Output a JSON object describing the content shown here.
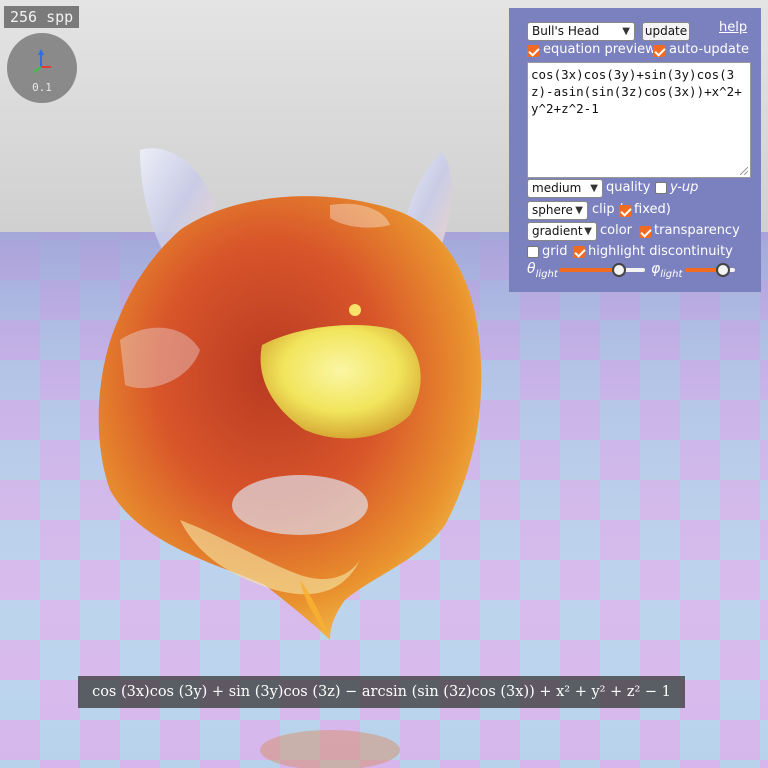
{
  "viewport": {
    "spp_label": "256 spp",
    "axis_scale": "0.1",
    "axis_colors": {
      "x": "#e23b3b",
      "y": "#2f6fe0",
      "z": "#3fbf4a"
    }
  },
  "panel": {
    "preset_select": "Bull's Head",
    "update_button": "update",
    "help_link": "help",
    "equation_preview": {
      "label": "equation preview",
      "checked": true
    },
    "auto_update": {
      "label": "auto-update",
      "checked": true
    },
    "equation_text": "cos(3x)cos(3y)+sin(3y)cos(3z)-asin(sin(3z)cos(3x))+x^2+y^2+z^2-1",
    "quality_select": "medium",
    "quality_label": "quality",
    "y_up": {
      "label": "y-up",
      "checked": false
    },
    "clip_select": "sphere",
    "clip_label": "clip (",
    "clip_fixed": {
      "label": "fixed)",
      "checked": true
    },
    "color_select": "gradient",
    "color_label": "color",
    "transparency": {
      "label": "transparency",
      "checked": true
    },
    "grid": {
      "label": "grid",
      "checked": false
    },
    "highlight_discontinuity": {
      "label": "highlight discontinuity",
      "checked": true
    },
    "theta_light": {
      "symbol": "θ",
      "subscript": "light",
      "value_fraction": 0.72
    },
    "phi_light": {
      "symbol": "φ",
      "subscript": "light",
      "value_fraction": 0.85
    },
    "accent_color": "#f26b21",
    "background_color": "#7b80bf"
  },
  "formula_preview": "cos (3x)cos (3y) + sin (3y)cos (3z) − arcsin (sin (3z)cos (3x)) + x² + y² + z² − 1"
}
